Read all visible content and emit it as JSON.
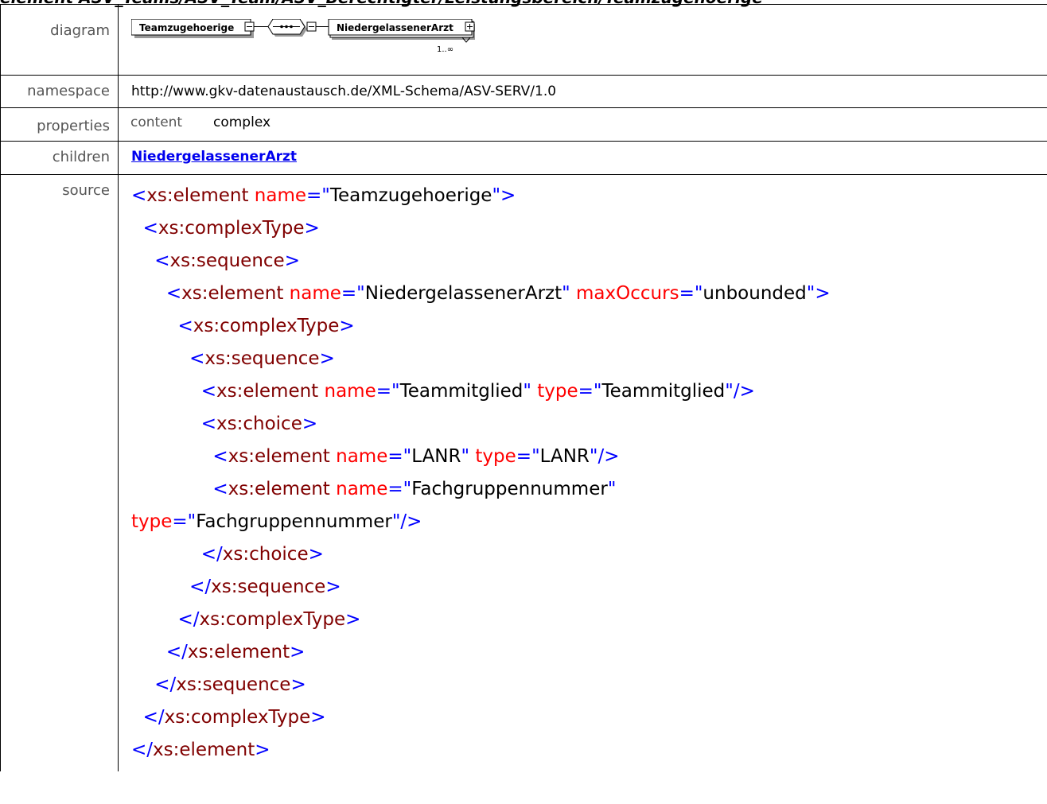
{
  "header": {
    "title": "element ASV_Teams/ASV_Team/ASV_Berechtigter/Leistungsbereich/Teamzugehoerige"
  },
  "rows": {
    "diagram": {
      "label": "diagram"
    },
    "namespace": {
      "label": "namespace",
      "value": "http://www.gkv-datenaustausch.de/XML-Schema/ASV-SERV/1.0"
    },
    "properties": {
      "label": "properties",
      "key": "content",
      "value": "complex"
    },
    "children": {
      "label": "children",
      "link": "NiedergelassenerArzt"
    },
    "source": {
      "label": "source"
    }
  },
  "diagram": {
    "root_element": "Teamzugehoerige",
    "child_element": "NiedergelassenerArzt",
    "occurrence": "1..∞",
    "compositor_icon": "sequence-compositor-icon",
    "expand_icon": "plus-box-icon"
  },
  "source": {
    "lines": [
      [
        {
          "c": "b",
          "t": "<"
        },
        {
          "c": "t",
          "t": "xs:element"
        },
        {
          "c": "v",
          "t": " "
        },
        {
          "c": "a",
          "t": "name"
        },
        {
          "c": "b",
          "t": "=\""
        },
        {
          "c": "v",
          "t": "Teamzugehoerige"
        },
        {
          "c": "b",
          "t": "\">"
        }
      ],
      [
        {
          "c": "v",
          "t": "  "
        },
        {
          "c": "b",
          "t": "<"
        },
        {
          "c": "t",
          "t": "xs:complexType"
        },
        {
          "c": "b",
          "t": ">"
        }
      ],
      [
        {
          "c": "v",
          "t": "    "
        },
        {
          "c": "b",
          "t": "<"
        },
        {
          "c": "t",
          "t": "xs:sequence"
        },
        {
          "c": "b",
          "t": ">"
        }
      ],
      [
        {
          "c": "v",
          "t": "      "
        },
        {
          "c": "b",
          "t": "<"
        },
        {
          "c": "t",
          "t": "xs:element"
        },
        {
          "c": "v",
          "t": " "
        },
        {
          "c": "a",
          "t": "name"
        },
        {
          "c": "b",
          "t": "=\""
        },
        {
          "c": "v",
          "t": "NiedergelassenerArzt"
        },
        {
          "c": "b",
          "t": "\""
        },
        {
          "c": "v",
          "t": " "
        },
        {
          "c": "a",
          "t": "maxOccurs"
        },
        {
          "c": "b",
          "t": "=\""
        },
        {
          "c": "v",
          "t": "unbounded"
        },
        {
          "c": "b",
          "t": "\">"
        }
      ],
      [
        {
          "c": "v",
          "t": "        "
        },
        {
          "c": "b",
          "t": "<"
        },
        {
          "c": "t",
          "t": "xs:complexType"
        },
        {
          "c": "b",
          "t": ">"
        }
      ],
      [
        {
          "c": "v",
          "t": "          "
        },
        {
          "c": "b",
          "t": "<"
        },
        {
          "c": "t",
          "t": "xs:sequence"
        },
        {
          "c": "b",
          "t": ">"
        }
      ],
      [
        {
          "c": "v",
          "t": "            "
        },
        {
          "c": "b",
          "t": "<"
        },
        {
          "c": "t",
          "t": "xs:element"
        },
        {
          "c": "v",
          "t": " "
        },
        {
          "c": "a",
          "t": "name"
        },
        {
          "c": "b",
          "t": "=\""
        },
        {
          "c": "v",
          "t": "Teammitglied"
        },
        {
          "c": "b",
          "t": "\""
        },
        {
          "c": "v",
          "t": " "
        },
        {
          "c": "a",
          "t": "type"
        },
        {
          "c": "b",
          "t": "=\""
        },
        {
          "c": "v",
          "t": "Teammitglied"
        },
        {
          "c": "b",
          "t": "\"/>"
        }
      ],
      [
        {
          "c": "v",
          "t": "            "
        },
        {
          "c": "b",
          "t": "<"
        },
        {
          "c": "t",
          "t": "xs:choice"
        },
        {
          "c": "b",
          "t": ">"
        }
      ],
      [
        {
          "c": "v",
          "t": "              "
        },
        {
          "c": "b",
          "t": "<"
        },
        {
          "c": "t",
          "t": "xs:element"
        },
        {
          "c": "v",
          "t": " "
        },
        {
          "c": "a",
          "t": "name"
        },
        {
          "c": "b",
          "t": "=\""
        },
        {
          "c": "v",
          "t": "LANR"
        },
        {
          "c": "b",
          "t": "\""
        },
        {
          "c": "v",
          "t": " "
        },
        {
          "c": "a",
          "t": "type"
        },
        {
          "c": "b",
          "t": "=\""
        },
        {
          "c": "v",
          "t": "LANR"
        },
        {
          "c": "b",
          "t": "\"/>"
        }
      ],
      [
        {
          "c": "v",
          "t": "              "
        },
        {
          "c": "b",
          "t": "<"
        },
        {
          "c": "t",
          "t": "xs:element"
        },
        {
          "c": "v",
          "t": " "
        },
        {
          "c": "a",
          "t": "name"
        },
        {
          "c": "b",
          "t": "=\""
        },
        {
          "c": "v",
          "t": "Fachgruppennummer"
        },
        {
          "c": "b",
          "t": "\""
        }
      ],
      [
        {
          "c": "a",
          "t": "type"
        },
        {
          "c": "b",
          "t": "=\""
        },
        {
          "c": "v",
          "t": "Fachgruppennummer"
        },
        {
          "c": "b",
          "t": "\"/>"
        }
      ],
      [
        {
          "c": "v",
          "t": "            "
        },
        {
          "c": "b",
          "t": "</"
        },
        {
          "c": "t",
          "t": "xs:choice"
        },
        {
          "c": "b",
          "t": ">"
        }
      ],
      [
        {
          "c": "v",
          "t": "          "
        },
        {
          "c": "b",
          "t": "</"
        },
        {
          "c": "t",
          "t": "xs:sequence"
        },
        {
          "c": "b",
          "t": ">"
        }
      ],
      [
        {
          "c": "v",
          "t": "        "
        },
        {
          "c": "b",
          "t": "</"
        },
        {
          "c": "t",
          "t": "xs:complexType"
        },
        {
          "c": "b",
          "t": ">"
        }
      ],
      [
        {
          "c": "v",
          "t": "      "
        },
        {
          "c": "b",
          "t": "</"
        },
        {
          "c": "t",
          "t": "xs:element"
        },
        {
          "c": "b",
          "t": ">"
        }
      ],
      [
        {
          "c": "v",
          "t": "    "
        },
        {
          "c": "b",
          "t": "</"
        },
        {
          "c": "t",
          "t": "xs:sequence"
        },
        {
          "c": "b",
          "t": ">"
        }
      ],
      [
        {
          "c": "v",
          "t": "  "
        },
        {
          "c": "b",
          "t": "</"
        },
        {
          "c": "t",
          "t": "xs:complexType"
        },
        {
          "c": "b",
          "t": ">"
        }
      ],
      [
        {
          "c": "b",
          "t": "</"
        },
        {
          "c": "t",
          "t": "xs:element"
        },
        {
          "c": "b",
          "t": ">"
        }
      ]
    ]
  }
}
